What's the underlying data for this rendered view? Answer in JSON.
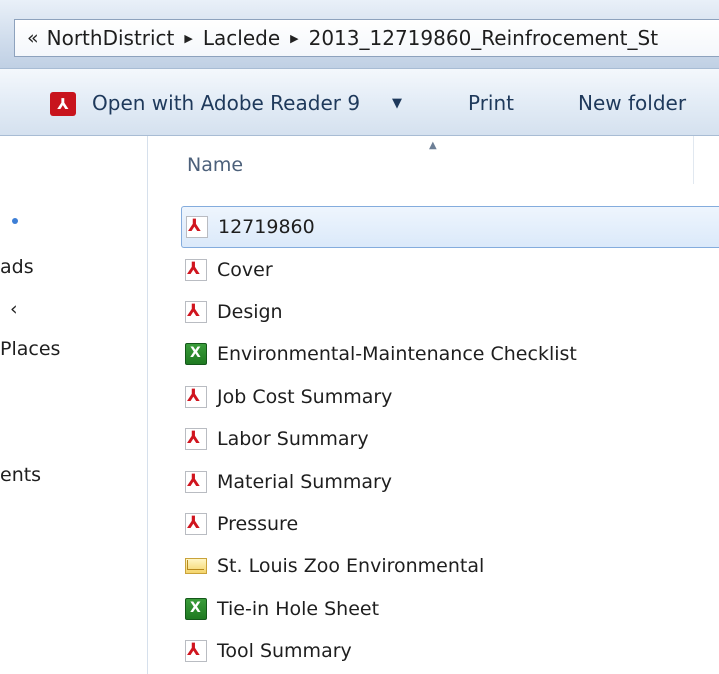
{
  "address_bar": {
    "chevron": "«",
    "crumbs": [
      "NorthDistrict",
      "Laclede",
      "2013_12719860_Reinfrocement_St"
    ],
    "separator": "▶"
  },
  "toolbar": {
    "open_with_label": "Open with Adobe Reader 9",
    "open_with_icon": "adobe-reader-icon",
    "dropdown_arrow": "▼",
    "print_label": "Print",
    "new_folder_label": "New folder"
  },
  "nav_pane": {
    "items": [
      "ads",
      "‹",
      "Places",
      "ents"
    ]
  },
  "file_list": {
    "column_header": "Name",
    "sort_indicator": "▲",
    "files": [
      {
        "name": "12719860",
        "type": "pdf",
        "icon": "pdf-file-icon",
        "selected": true
      },
      {
        "name": "Cover",
        "type": "pdf",
        "icon": "pdf-file-icon"
      },
      {
        "name": "Design",
        "type": "pdf",
        "icon": "pdf-file-icon"
      },
      {
        "name": "Environmental-Maintenance Checklist",
        "type": "xls",
        "icon": "excel-file-icon"
      },
      {
        "name": "Job Cost Summary",
        "type": "pdf",
        "icon": "pdf-file-icon"
      },
      {
        "name": "Labor Summary",
        "type": "pdf",
        "icon": "pdf-file-icon"
      },
      {
        "name": "Material Summary",
        "type": "pdf",
        "icon": "pdf-file-icon"
      },
      {
        "name": "Pressure",
        "type": "pdf",
        "icon": "pdf-file-icon"
      },
      {
        "name": "St. Louis Zoo Environmental",
        "type": "msg",
        "icon": "email-message-icon"
      },
      {
        "name": "Tie-in Hole Sheet",
        "type": "xls",
        "icon": "excel-file-icon"
      },
      {
        "name": "Tool Summary",
        "type": "pdf",
        "icon": "pdf-file-icon"
      }
    ]
  },
  "colors": {
    "selection_border": "#84acdd",
    "acrobat_red": "#c8141d",
    "toolbar_text": "#1e395b"
  }
}
